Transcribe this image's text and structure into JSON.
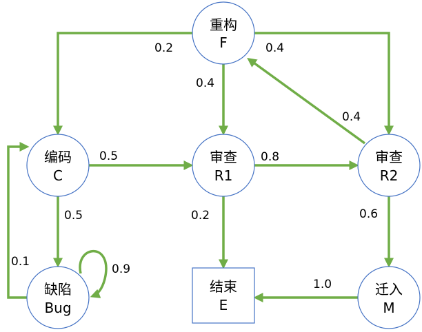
{
  "colors": {
    "edge": "#70AD47",
    "node_stroke": "#4472C4",
    "box_stroke": "#4472C4"
  },
  "nodes": {
    "F": {
      "name": "重构",
      "code": "F"
    },
    "C": {
      "name": "编码",
      "code": "C"
    },
    "R1": {
      "name": "审查",
      "code": "R1"
    },
    "R2": {
      "name": "审查",
      "code": "R2"
    },
    "Bug": {
      "name": "缺陷",
      "code": "Bug"
    },
    "E": {
      "name": "结束",
      "code": "E"
    },
    "M": {
      "name": "迁入",
      "code": "M"
    }
  },
  "edges": {
    "F_C": "0.2",
    "F_R2": "0.4",
    "F_R1": "0.4",
    "R2_F": "0.4",
    "C_R1": "0.5",
    "R1_R2": "0.8",
    "C_Bug": "0.5",
    "Bug_C": "0.1",
    "Bug_Bug": "0.9",
    "R1_E": "0.2",
    "R2_M": "0.6",
    "M_E": "1.0"
  }
}
